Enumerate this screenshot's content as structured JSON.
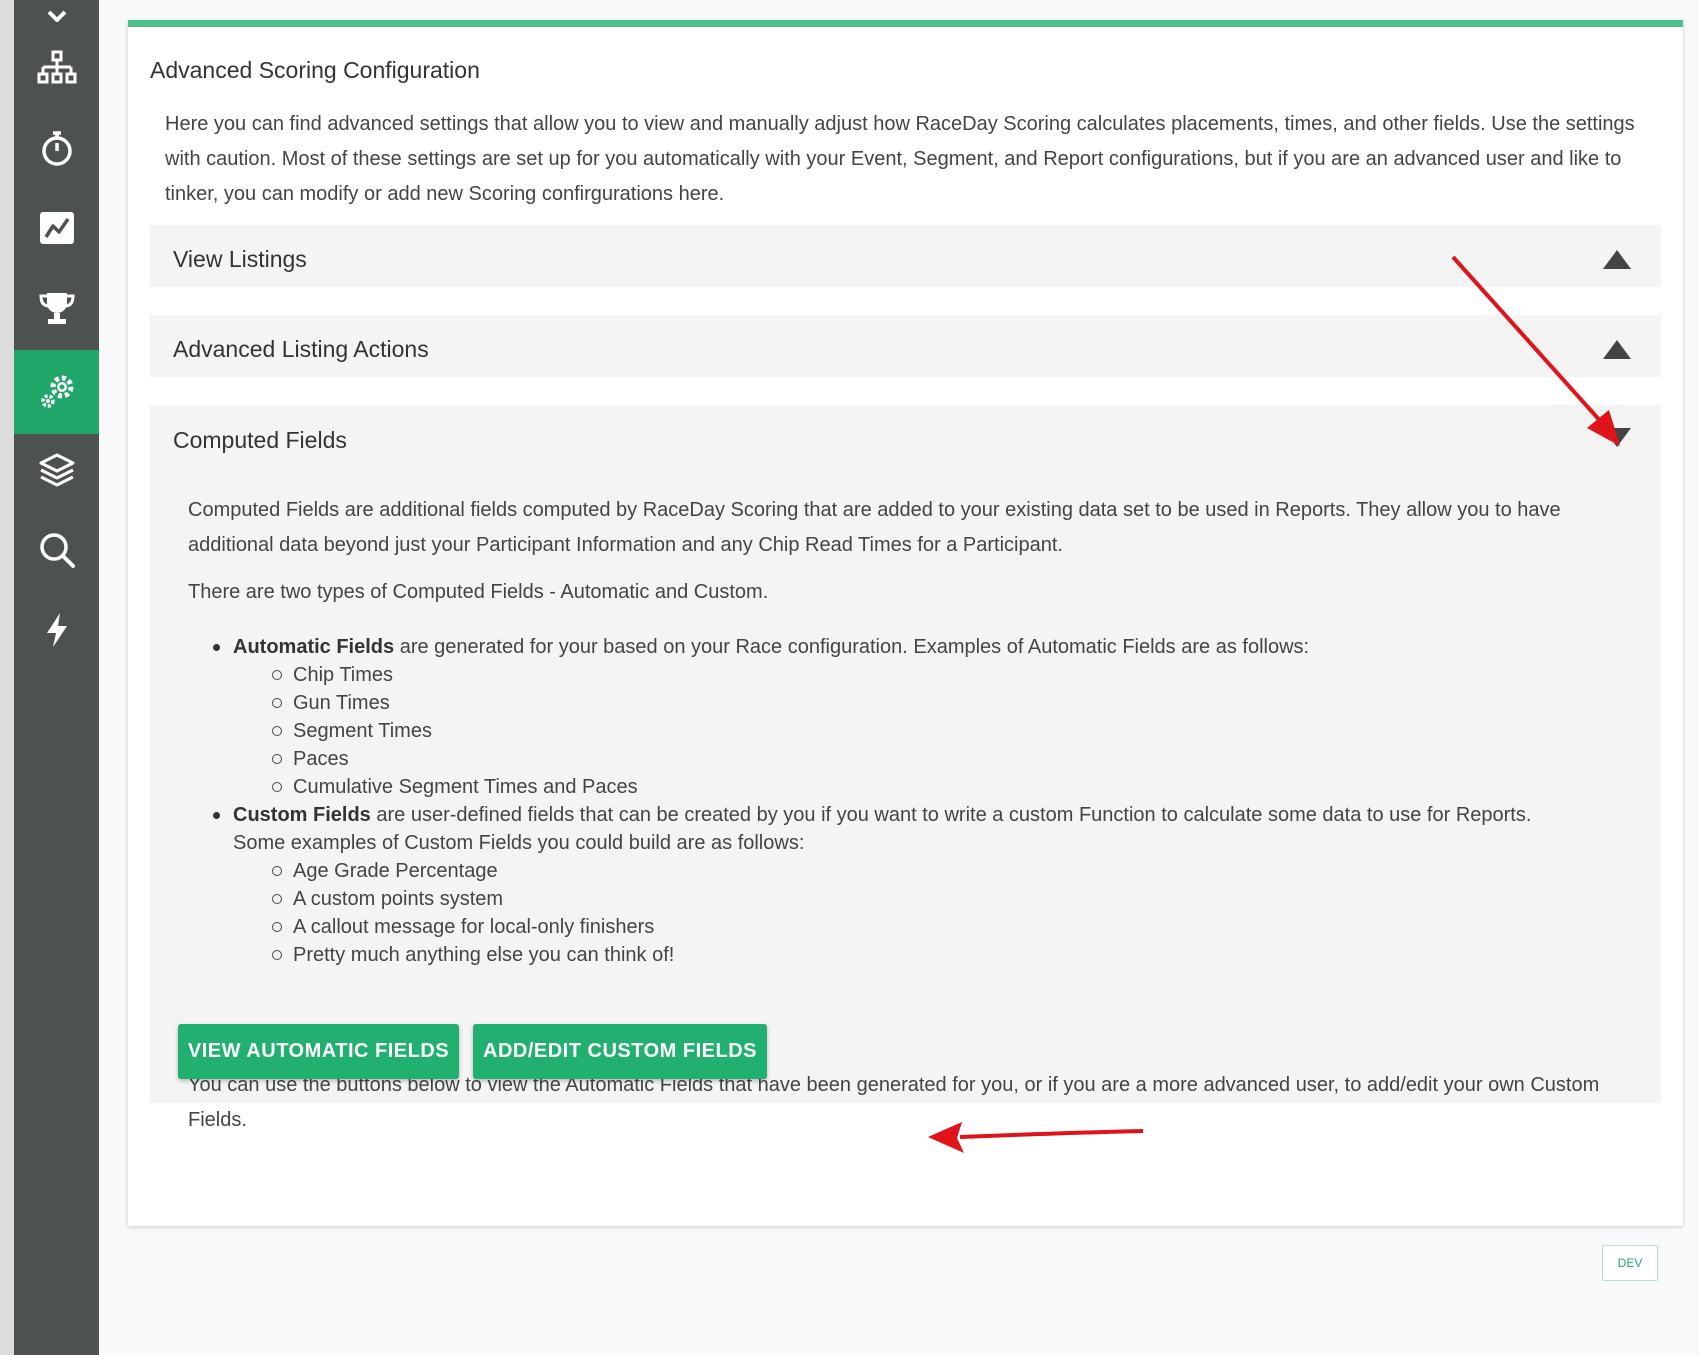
{
  "sidebar": {
    "items": [
      {
        "icon": "sitemap-icon",
        "active": false
      },
      {
        "icon": "stopwatch-icon",
        "active": false
      },
      {
        "icon": "chart-line-icon",
        "active": false
      },
      {
        "icon": "trophy-icon",
        "active": false
      },
      {
        "icon": "gears-icon",
        "active": true
      },
      {
        "icon": "layers-icon",
        "active": false
      },
      {
        "icon": "search-icon",
        "active": false
      },
      {
        "icon": "bolt-icon",
        "active": false
      }
    ],
    "active_color": "#21a66a",
    "background": "#4d5250"
  },
  "card": {
    "title": "Advanced Scoring Configuration",
    "intro": "Here you can find advanced settings that allow you to view and manually adjust how RaceDay Scoring calculates placements, times, and other fields. Use the settings with caution. Most of these settings are set up for you automatically with your Event, Segment, and Report configurations, but if you are an advanced user and like to tinker, you can modify or add new Scoring confirgurations here.",
    "accent_color": "#4dbf8a"
  },
  "panels": {
    "view_listings": {
      "title": "View Listings",
      "state": "collapsed"
    },
    "advanced_listing_actions": {
      "title": "Advanced Listing Actions",
      "state": "collapsed"
    },
    "computed_fields": {
      "title": "Computed Fields",
      "state": "expanded",
      "p1": "Computed Fields are additional fields computed by RaceDay Scoring that are added to your existing data set to be used in Reports. They allow you to have additional data beyond just your Participant Information and any Chip Read Times for a Participant.",
      "p2": "There are two types of Computed Fields - Automatic and Custom.",
      "automatic": {
        "bold": "Automatic Fields",
        "text": " are generated for your based on your Race configuration. Examples of Automatic Fields are as follows:",
        "items": [
          "Chip Times",
          "Gun Times",
          "Segment Times",
          "Paces",
          "Cumulative Segment Times and Paces"
        ]
      },
      "custom": {
        "bold": "Custom Fields",
        "text": " are user-defined fields that can be created by you if you want to write a custom Function to calculate some data to use for Reports.",
        "text2": "Some examples of Custom Fields you could build are as follows:",
        "items": [
          "Age Grade Percentage",
          "A custom points system",
          "A callout message for local-only finishers",
          "Pretty much anything else you can think of!"
        ]
      },
      "p3": "You can use the buttons below to view the Automatic Fields that have been generated for you, or if you are a more advanced user, to add/edit your own Custom Fields.",
      "buttons": {
        "view_automatic": "VIEW AUTOMATIC FIELDS",
        "add_edit_custom": "ADD/EDIT CUSTOM FIELDS"
      },
      "button_color": "#21b070"
    }
  },
  "footer": {
    "dev_badge": "DEV"
  },
  "annotation_color": "#e0121a"
}
